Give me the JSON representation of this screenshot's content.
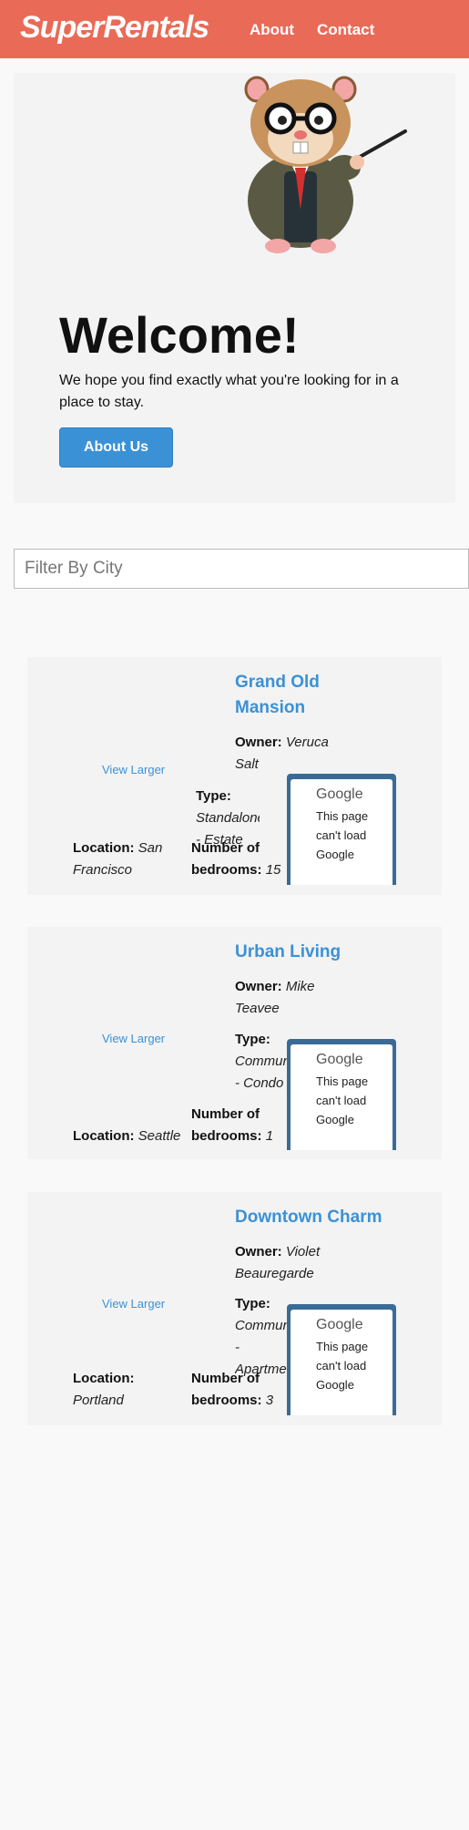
{
  "header": {
    "brand": "SuperRentals",
    "nav": [
      "About",
      "Contact"
    ]
  },
  "jumbo": {
    "heading": "Welcome!",
    "text": "We hope you find exactly what you're looking for in a place to stay.",
    "button": "About Us"
  },
  "filter": {
    "placeholder": "Filter By City"
  },
  "rentals": [
    {
      "view_larger": "View Larger",
      "title": "Grand Old Mansion",
      "owner_label": "Owner:",
      "owner": "Veruca Salt",
      "type_label": "Type:",
      "type": "Standalone - Estate",
      "location_label": "Location:",
      "location": "San Francisco",
      "beds_label": "Number of bedrooms:",
      "beds": "15",
      "map": {
        "logo": "Google",
        "message": "This page can't load Google"
      }
    },
    {
      "view_larger": "View Larger",
      "title": "Urban Living",
      "owner_label": "Owner:",
      "owner": "Mike Teavee",
      "type_label": "Type:",
      "type": "Community - Condo",
      "location_label": "Location:",
      "location": "Seattle",
      "beds_label": "Number of bedrooms:",
      "beds": "1",
      "map": {
        "logo": "Google",
        "message": "This page can't load Google"
      }
    },
    {
      "view_larger": "View Larger",
      "title": "Downtown Charm",
      "owner_label": "Owner:",
      "owner": "Violet Beauregarde",
      "type_label": "Type:",
      "type": "Community - Apartment",
      "location_label": "Location:",
      "location": "Portland",
      "beds_label": "Number of bedrooms:",
      "beds": "3",
      "map": {
        "logo": "Google",
        "message": "This page can't load Google"
      }
    }
  ],
  "colors": {
    "header": "#e96b57",
    "accent": "#3b91d6",
    "card": "#f3f3f3"
  }
}
